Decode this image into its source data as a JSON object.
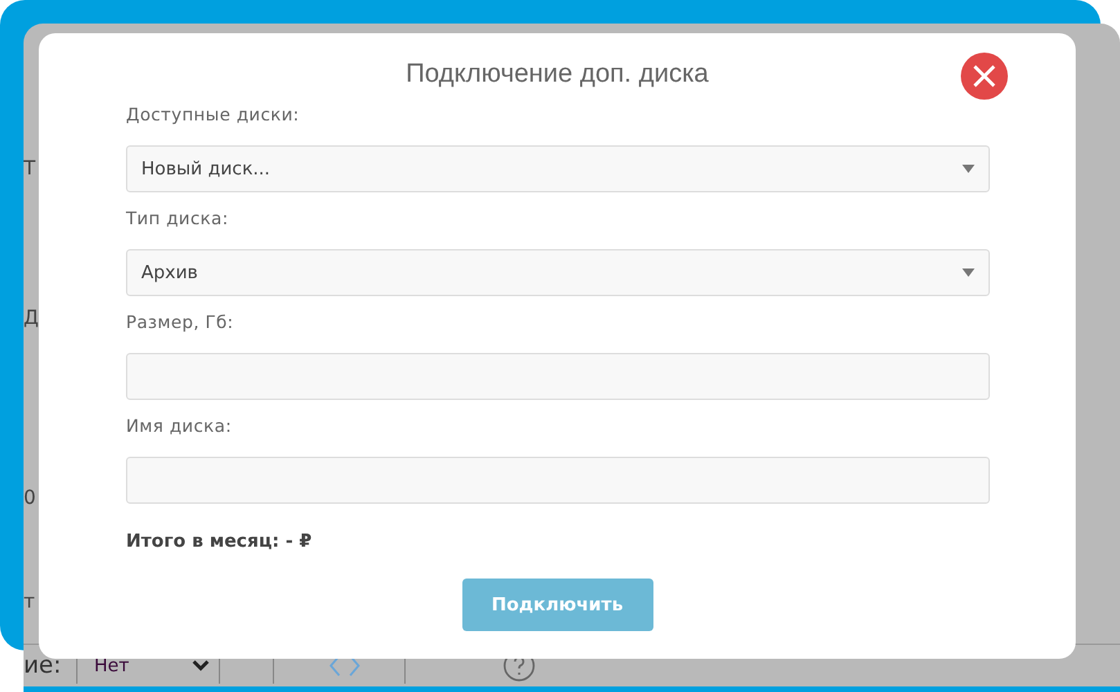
{
  "background": {
    "fragments": [
      "Т",
      "Д",
      "0",
      "т"
    ],
    "bottom_bar": {
      "label": "ие:",
      "select_value": "Нет"
    }
  },
  "dialog": {
    "title": "Подключение доп. диска",
    "fields": [
      {
        "label": "Доступные диски:",
        "kind": "select",
        "value": "Новый диск..."
      },
      {
        "label": "Тип диска:",
        "kind": "select",
        "value": "Архив"
      },
      {
        "label": "Размер, Гб:",
        "kind": "input"
      },
      {
        "label": "Имя диска:",
        "kind": "input"
      }
    ],
    "total": "Итого в месяц: - ₽",
    "submit": {
      "label": "Подключить",
      "disabled": true
    }
  }
}
